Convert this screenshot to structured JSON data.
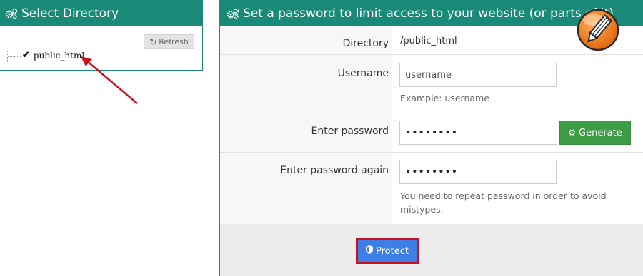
{
  "left_panel": {
    "title": "Select Directory",
    "refresh_label": "Refresh",
    "tree": [
      {
        "label": "public_html",
        "selected": true
      }
    ]
  },
  "right_panel": {
    "title": "Set a password to limit access to your website (or parts of it)",
    "rows": {
      "directory": {
        "label": "Directory",
        "value": "/public_html"
      },
      "username": {
        "label": "Username",
        "value": "username",
        "help": "Example: username"
      },
      "password": {
        "label": "Enter password",
        "value": "••••••••",
        "generate_label": "Generate"
      },
      "password_again": {
        "label": "Enter password again",
        "value": "••••••••",
        "help": "You need to repeat password in order to avoid mistypes."
      }
    },
    "protect_label": "Protect"
  },
  "icons": {
    "header": "cogs-icon",
    "refresh": "refresh-icon",
    "check": "check-icon",
    "generate": "gear-icon",
    "protect": "shield-icon",
    "badge": "pencil-icon"
  },
  "colors": {
    "header_bg": "#1a8a78",
    "generate_bg": "#3d9d44",
    "protect_bg": "#3d7fe6",
    "annotation_red": "#c8131f"
  }
}
